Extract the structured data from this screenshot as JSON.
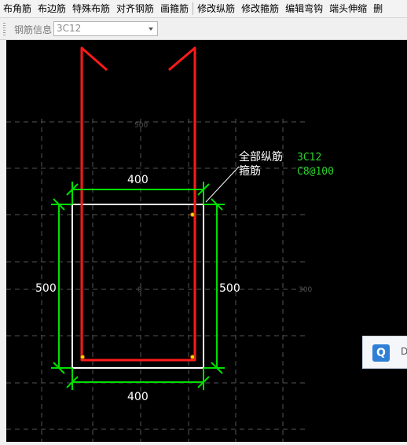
{
  "toolbar": {
    "items": [
      "布角筋",
      "布边筋",
      "特殊布筋",
      "对齐钢筋",
      "画箍筋",
      "修改纵筋",
      "修改箍筋",
      "编辑弯钩",
      "端头伸缩",
      "删"
    ]
  },
  "info": {
    "label": "钢筋信息",
    "value": "3C12"
  },
  "drawing": {
    "dim_top": "400",
    "dim_bottom": "400",
    "dim_left": "500",
    "dim_right": "500",
    "grid_label_top": "500",
    "grid_label_right": "300",
    "origin_label": "0",
    "annotation_label_1": "全部纵筋",
    "annotation_value_1": "3C12",
    "annotation_label_2": "箍筋",
    "annotation_value_2": "C8@100",
    "colors": {
      "background": "#000000",
      "rebar": "#ff1a1a",
      "dimension": "#00e000",
      "section": "#ffffff",
      "spec": "#2bd62b",
      "grid": "#555555"
    }
  },
  "float_panel": {
    "icon_text": "Q",
    "trailing_text": "D"
  }
}
